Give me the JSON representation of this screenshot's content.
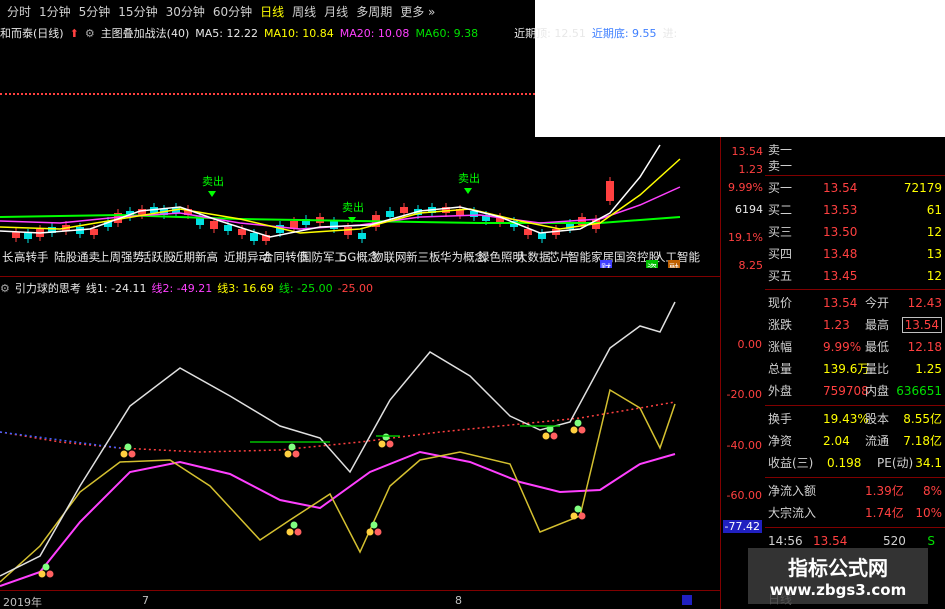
{
  "periods": [
    "分时",
    "1分钟",
    "5分钟",
    "15分钟",
    "30分钟",
    "60分钟",
    "日线",
    "周线",
    "月线",
    "多周期",
    "更多 »"
  ],
  "active_period": "日线",
  "main": {
    "stock": "和而泰(日线)",
    "indicator": "主图叠加战法(40)",
    "ma5": "MA5: 12.22",
    "ma10": "MA10: 10.84",
    "ma20": "MA20: 10.08",
    "ma60": "MA60: 9.38",
    "recent_label": "近期顶: 12.51",
    "recent_extra": "近期底: 9.55",
    "jin": "进:"
  },
  "price_axis": [
    "13.54",
    "1.23",
    "9.99%",
    "6194",
    "19.1%",
    "8.25"
  ],
  "sectors": [
    "长",
    "高转手",
    "陆股通卖",
    "上周强势",
    "活跃股",
    "近期新高",
    "近期异动",
    "合同转债",
    "国防军工",
    "5G概念",
    "物联网",
    "新三板",
    "华为概念",
    "绿色照明",
    "大数据",
    "芯片",
    "智能家居",
    "国资控股",
    "人工智能"
  ],
  "bottom_tags": [
    "财",
    "资",
    "融"
  ],
  "signals": [
    "卖出",
    "卖出",
    "卖出"
  ],
  "indicator": {
    "name": "引力球的思考",
    "line1": "线1: -24.11",
    "line2": "线2: -49.21",
    "line3": "线3: 16.69",
    "line4": "线: -25.00",
    "line5": "-25.00"
  },
  "ind_axis": [
    "0.00",
    "-20.00",
    "-40.00",
    "-60.00",
    "-77.42"
  ],
  "dates": [
    "2019年",
    "7",
    "8"
  ],
  "quote": {
    "sell_orders": [
      {
        "label": "卖一"
      },
      {
        "label": "卖一"
      }
    ],
    "buy_orders": [
      {
        "label": "买一",
        "price": "13.54",
        "vol": "72179"
      },
      {
        "label": "买二",
        "price": "13.53",
        "vol": "61"
      },
      {
        "label": "买三",
        "price": "13.50",
        "vol": "12"
      },
      {
        "label": "买四",
        "price": "13.48",
        "vol": "13"
      },
      {
        "label": "买五",
        "price": "13.45",
        "vol": "12"
      }
    ],
    "stats": [
      {
        "l1": "现价",
        "v1": "13.54",
        "l2": "今开",
        "v2": "12.43"
      },
      {
        "l1": "涨跌",
        "v1": "1.23",
        "l2": "最高",
        "v2": "13.54"
      },
      {
        "l1": "涨幅",
        "v1": "9.99%",
        "l2": "最低",
        "v2": "12.18"
      },
      {
        "l1": "总量",
        "v1": "139.6万",
        "l2": "量比",
        "v2": "1.25"
      },
      {
        "l1": "外盘",
        "v1": "759708",
        "l2": "内盘",
        "v2": "636651"
      }
    ],
    "finance": [
      {
        "l1": "换手",
        "v1": "19.43%",
        "l2": "股本",
        "v2": "8.55亿"
      },
      {
        "l1": "净资",
        "v1": "2.04",
        "l2": "流通",
        "v2": "7.18亿"
      },
      {
        "l1": "收益(三)",
        "v1": "0.198",
        "l2": "PE(动)",
        "v2": "34.1"
      }
    ],
    "flows": [
      {
        "label": "净流入额",
        "value": "1.39亿",
        "pct": "8%"
      },
      {
        "label": "大宗流入",
        "value": "1.74亿",
        "pct": "10%"
      }
    ],
    "tick": {
      "time": "14:56",
      "price": "13.54",
      "vol": "520",
      "flag": "S"
    },
    "bottom_label": "日线"
  },
  "watermark": {
    "line1": "指标公式网",
    "line2": "www.zbgs3.com"
  },
  "colors": {
    "up": "#ff4040",
    "down": "#00e0e0",
    "ma5": "#ffffff",
    "ma10": "#ffff00",
    "ma20": "#ff40ff",
    "ma60": "#00ff00"
  }
}
